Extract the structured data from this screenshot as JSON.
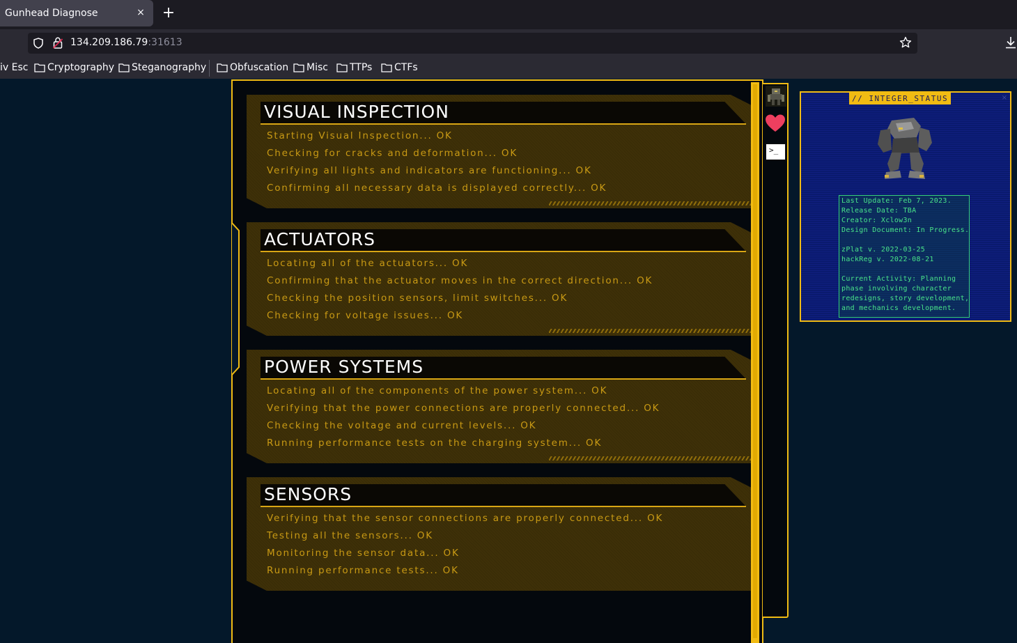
{
  "browser": {
    "tab_title": "Gunhead Diagnose",
    "tab_close": "×",
    "new_tab": "+",
    "url_host": "134.209.186.79",
    "url_port": ":31613"
  },
  "bookmarks": [
    {
      "label": "iv Esc"
    },
    {
      "label": "Cryptography"
    },
    {
      "label": "Steganography"
    },
    {
      "label": "Obfuscation"
    },
    {
      "label": "Misc"
    },
    {
      "label": "TTPs"
    },
    {
      "label": "CTFs"
    }
  ],
  "sections": [
    {
      "title": "VISUAL INSPECTION",
      "lines": [
        "Starting Visual Inspection... OK",
        "Checking for cracks and deformation... OK",
        "Verifying all lights and indicators are functioning... OK",
        "Confirming all necessary data is displayed correctly... OK"
      ]
    },
    {
      "title": "ACTUATORS",
      "lines": [
        "Locating all of the actuators... OK",
        "Confirming that the actuator moves in the correct direction... OK",
        "Checking the position sensors, limit switches... OK",
        "Checking for voltage issues... OK"
      ]
    },
    {
      "title": "POWER SYSTEMS",
      "lines": [
        "Locating all of the components of the power system... OK",
        "Verifying that the power connections are properly connected... OK",
        "Checking the voltage and current levels... OK",
        "Running performance tests on the charging system... OK"
      ]
    },
    {
      "title": "SENSORS",
      "lines": [
        "Verifying that the sensor connections are properly connected... OK",
        "Testing all the sensors... OK",
        "Monitoring the sensor data... OK",
        "Running performance tests... OK"
      ]
    }
  ],
  "side": {
    "terminal_glyph": ">_"
  },
  "status": {
    "tag": "// INTEGER_STATUS",
    "close": "×",
    "lines": [
      "Last Update: Feb 7, 2023.",
      "Release Date: TBA",
      "Creator: Xclow3n",
      "Design Document: In Progress.",
      "",
      "zPlat v. 2022-03-25",
      "hackReg v. 2022-08-21",
      "",
      "Current Activity: Planning",
      "phase involving character",
      "redesigns, story development,",
      "and mechanics development."
    ]
  },
  "colors": {
    "accent": "#f1bb13",
    "text_gold": "#c99a14",
    "terminal_green": "#49e48a",
    "panel_blue": "#0a1a6e",
    "page_bg": "#04182a"
  }
}
